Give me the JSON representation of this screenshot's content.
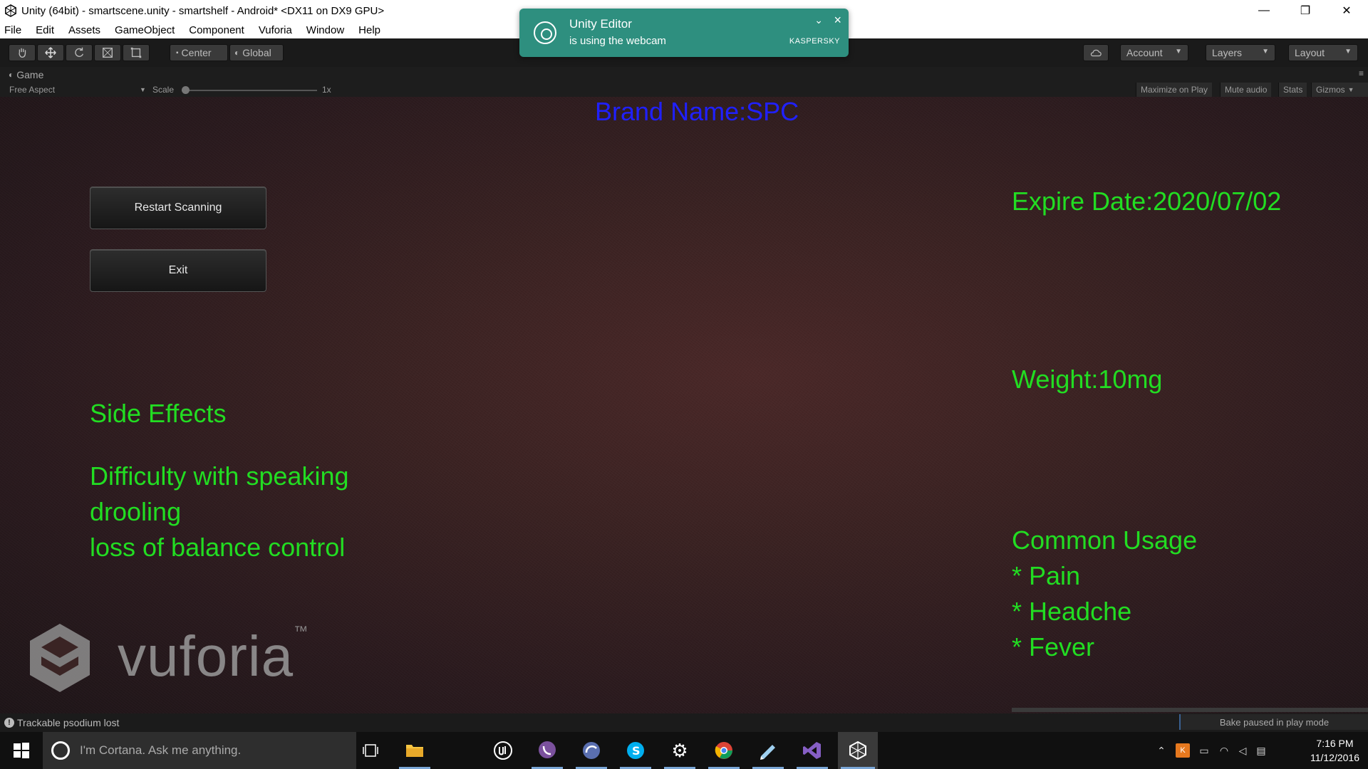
{
  "window": {
    "title": "Unity (64bit) - smartscene.unity - smartshelf - Android* <DX11 on DX9 GPU>",
    "minimize_glyph": "—",
    "restore_glyph": "❐",
    "close_glyph": "✕"
  },
  "menu": [
    "File",
    "Edit",
    "Assets",
    "GameObject",
    "Component",
    "Vuforia",
    "Window",
    "Help"
  ],
  "toolbar": {
    "pivot_label": "Center",
    "space_label": "Global",
    "account_label": "Account",
    "layers_label": "Layers",
    "layout_label": "Layout"
  },
  "game_panel": {
    "tab_label": "Game",
    "aspect_label": "Free Aspect",
    "scale_label": "Scale",
    "scale_value": "1x",
    "maximize_label": "Maximize on Play",
    "mute_label": "Mute audio",
    "stats_label": "Stats",
    "gizmos_label": "Gizmos"
  },
  "ar": {
    "brand_name": "Brand Name:SPC",
    "restart_button": "Restart Scanning",
    "exit_button": "Exit",
    "expire_date": "Expire Date:2020/07/02",
    "weight": "Weight:10mg",
    "side_effects_title": "Side Effects",
    "side_effects": [
      "Difficulty with speaking",
      "drooling",
      "loss of balance control"
    ],
    "common_usage_title": "Common Usage",
    "common_usage": [
      "* Pain",
      "* Headche",
      "* Fever"
    ],
    "logo_text": "vuforia",
    "logo_tm": "™"
  },
  "status": {
    "message": "Trackable psodium lost",
    "bake_status": "Bake paused in play mode"
  },
  "notification": {
    "title": "Unity Editor",
    "message": "is using the webcam",
    "brand": "KASPERSKY"
  },
  "taskbar": {
    "cortana_placeholder": "I'm Cortana. Ask me anything.",
    "time": "7:16 PM",
    "date": "11/12/2016"
  },
  "colors": {
    "ar_text": "#22dd22",
    "brand_text": "#2020ff",
    "toast_bg": "#2e8f7f"
  }
}
